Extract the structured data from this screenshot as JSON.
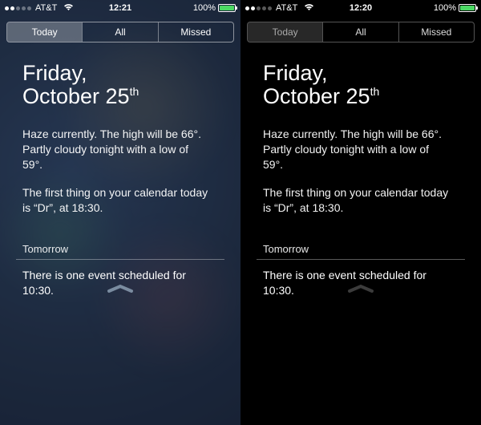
{
  "left": {
    "status": {
      "carrier": "AT&T",
      "time": "12:21",
      "battery_pct": "100%"
    },
    "tabs": {
      "today": "Today",
      "all": "All",
      "missed": "Missed",
      "selected": "today"
    },
    "date": {
      "day": "Friday,",
      "month_day": "October 25",
      "ordinal": "th"
    },
    "weather": "Haze currently. The high will be 66°. Partly cloudy tonight with a low of 59°.",
    "calendar_today": "The first thing on your calendar today is “Dr”, at 18:30.",
    "tomorrow_label": "Tomorrow",
    "tomorrow_body": "There is one event scheduled for 10:30."
  },
  "right": {
    "status": {
      "carrier": "AT&T",
      "time": "12:20",
      "battery_pct": "100%"
    },
    "tabs": {
      "today": "Today",
      "all": "All",
      "missed": "Missed",
      "selected": "today"
    },
    "date": {
      "day": "Friday,",
      "month_day": "October 25",
      "ordinal": "th"
    },
    "weather": "Haze currently. The high will be 66°. Partly cloudy tonight with a low of 59°.",
    "calendar_today": "The first thing on your calendar today is “Dr”, at 18:30.",
    "tomorrow_label": "Tomorrow",
    "tomorrow_body": "There is one event scheduled for 10:30."
  }
}
